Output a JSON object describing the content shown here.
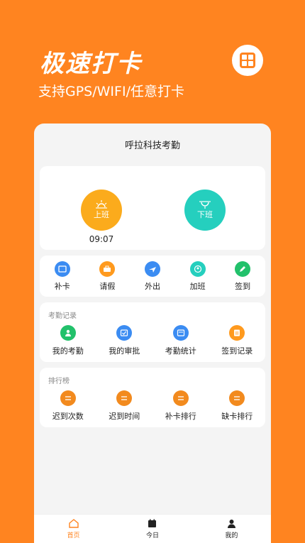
{
  "hero": {
    "title": "极速打卡",
    "subtitle": "支持GPS/WIFI/任意打卡"
  },
  "app": {
    "title": "呼拉科技考勤"
  },
  "punch": {
    "in_label": "上班",
    "in_time": "09:07",
    "out_label": "下班"
  },
  "actions": [
    {
      "label": "补卡",
      "icon": "card-icon",
      "color": "#3B8CF2"
    },
    {
      "label": "请假",
      "icon": "leave-icon",
      "color": "#FF9A1E"
    },
    {
      "label": "外出",
      "icon": "plane-icon",
      "color": "#3B8CF2"
    },
    {
      "label": "加班",
      "icon": "overtime-icon",
      "color": "#25CFBE"
    },
    {
      "label": "签到",
      "icon": "sign-icon",
      "color": "#22C16B"
    }
  ],
  "records": {
    "title": "考勤记录",
    "items": [
      {
        "label": "我的考勤",
        "icon": "user-icon",
        "color": "#22C16B"
      },
      {
        "label": "我的审批",
        "icon": "approval-icon",
        "color": "#3B8CF2"
      },
      {
        "label": "考勤统计",
        "icon": "stats-icon",
        "color": "#3B8CF2"
      },
      {
        "label": "签到记录",
        "icon": "record-icon",
        "color": "#FF9A1E"
      }
    ]
  },
  "ranking": {
    "title": "排行榜",
    "items": [
      {
        "label": "迟到次数",
        "icon": "swap-icon",
        "color": "#F28A1E"
      },
      {
        "label": "迟到时间",
        "icon": "swap-icon",
        "color": "#F28A1E"
      },
      {
        "label": "补卡排行",
        "icon": "swap-icon",
        "color": "#F28A1E"
      },
      {
        "label": "缺卡排行",
        "icon": "swap-icon",
        "color": "#F28A1E"
      }
    ]
  },
  "tabs": [
    {
      "label": "首页",
      "icon": "home-icon",
      "active": true
    },
    {
      "label": "今日",
      "icon": "calendar-icon",
      "active": false
    },
    {
      "label": "我的",
      "icon": "profile-icon",
      "active": false
    }
  ]
}
